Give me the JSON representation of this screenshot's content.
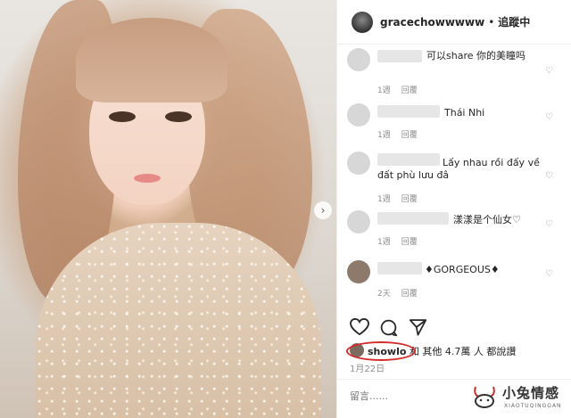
{
  "post": {
    "username": "gracechowwwww",
    "separator": "•",
    "follow_label": "追蹤中"
  },
  "comments": [
    {
      "text": "可以share 你的美瞳吗",
      "time": "1週",
      "reply": "回覆"
    },
    {
      "text": "Thái Nhi",
      "time": "1週",
      "reply": "回覆"
    },
    {
      "text": "Lấy nhau rồi đấy về đất phù lưu đâ",
      "time": "1週",
      "reply": "回覆"
    },
    {
      "text": "漾漾是个仙女♡",
      "time": "1週",
      "reply": "回覆"
    },
    {
      "text": "GORGEOUS",
      "time": "2天",
      "reply": "回覆"
    }
  ],
  "likes": {
    "user": "showlo",
    "rest": "和 其他 4.7萬 人 都說讚"
  },
  "date": "1月22日",
  "comment_input": {
    "placeholder": "留言......"
  },
  "watermark": {
    "title": "小兔情感",
    "subtitle": "XIAOTUQINGGAN"
  },
  "colors": {
    "highlight_circle": "#d42a2a",
    "meta_text": "#8e8e8e"
  },
  "icons": [
    "heart-icon",
    "comment-icon",
    "share-icon",
    "chevron-right-icon"
  ]
}
